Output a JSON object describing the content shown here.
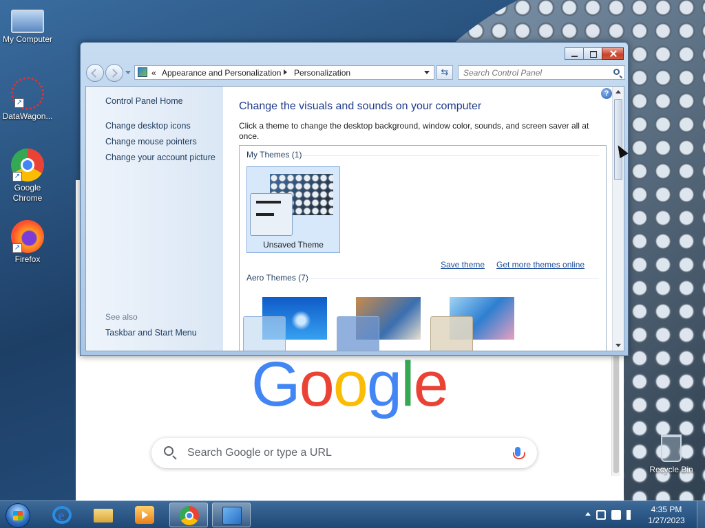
{
  "desktop": {
    "icons": [
      {
        "label": "My Computer"
      },
      {
        "label": "DataWagon..."
      },
      {
        "label": "Google Chrome"
      },
      {
        "label": "Firefox"
      }
    ],
    "recycle_bin": "Recycle Bin"
  },
  "chrome": {
    "search_placeholder": "Search Google or type a URL",
    "logo": [
      "G",
      "o",
      "o",
      "g",
      "l",
      "e"
    ]
  },
  "control_panel": {
    "breadcrumb_prefix": "«",
    "breadcrumb": [
      "Appearance and Personalization",
      "Personalization"
    ],
    "search_placeholder": "Search Control Panel",
    "left_links": [
      "Control Panel Home",
      "Change desktop icons",
      "Change mouse pointers",
      "Change your account picture"
    ],
    "see_also_label": "See also",
    "see_also_links": [
      "Taskbar and Start Menu"
    ],
    "title": "Change the visuals and sounds on your computer",
    "description": "Click a theme to change the desktop background, window color, sounds, and screen saver all at once.",
    "my_themes_heading": "My Themes (1)",
    "unsaved_theme": "Unsaved Theme",
    "save_theme": "Save theme",
    "get_more_themes": "Get more themes online",
    "aero_heading": "Aero Themes (7)",
    "help": "?"
  },
  "taskbar": {
    "time": "4:35 PM",
    "date": "1/27/2023"
  },
  "colors": {
    "link": "#1e4f9a",
    "title": "#1e3b8a",
    "taskbar": "#1e4876"
  }
}
